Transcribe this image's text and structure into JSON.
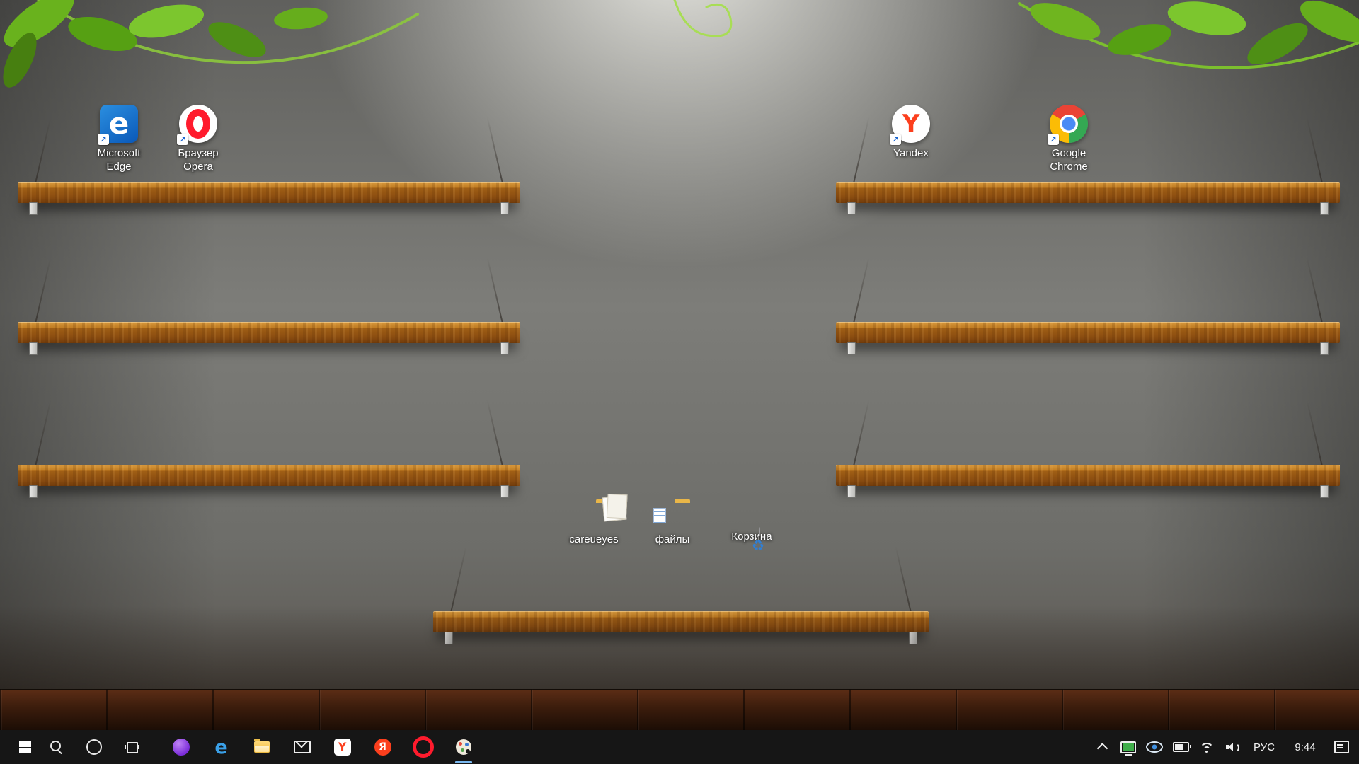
{
  "desktop": {
    "shortcuts": [
      {
        "id": "microsoft-edge",
        "label": "Microsoft Edge"
      },
      {
        "id": "opera",
        "label": "Браузер Opera"
      },
      {
        "id": "yandex",
        "label": "Yandex"
      },
      {
        "id": "google-chrome",
        "label": "Google Chrome"
      },
      {
        "id": "careueyes",
        "label": "careueyes"
      },
      {
        "id": "files",
        "label": "файлы"
      },
      {
        "id": "recycle-bin",
        "label": "Корзина"
      }
    ]
  },
  "glyphs": {
    "edge": "e",
    "yandex_y": "Y",
    "yandex_ya": "Я",
    "shortcut_arrow": "↗",
    "recycle": "♻"
  },
  "taskbar": {
    "items": [
      {
        "icon": "windows-logo"
      },
      {
        "icon": "search"
      },
      {
        "icon": "cortana"
      },
      {
        "icon": "task-view"
      },
      {
        "icon": "purple-app"
      },
      {
        "icon": "edge"
      },
      {
        "icon": "file-explorer"
      },
      {
        "icon": "mail"
      },
      {
        "icon": "yandex-browser"
      },
      {
        "icon": "yandex"
      },
      {
        "icon": "opera"
      },
      {
        "icon": "palette",
        "running": true
      }
    ],
    "tray": {
      "language": "РУС",
      "time": "9:44",
      "icons": [
        "chevron-up",
        "display",
        "eye",
        "battery",
        "wifi",
        "volume",
        "action-center"
      ]
    }
  },
  "colors": {
    "taskbar_bg": "#161616",
    "edge_blue": "#1273d4",
    "opera_red": "#ff1b2d",
    "yandex_red": "#fc3f1d",
    "chrome_red": "#ea4335",
    "chrome_yellow": "#fbbc05",
    "chrome_green": "#34a853",
    "chrome_blue": "#4285f4",
    "folder_yellow": "#f0c050",
    "shelf_wood": "#a9641a",
    "running_indicator": "#79b8f0"
  }
}
